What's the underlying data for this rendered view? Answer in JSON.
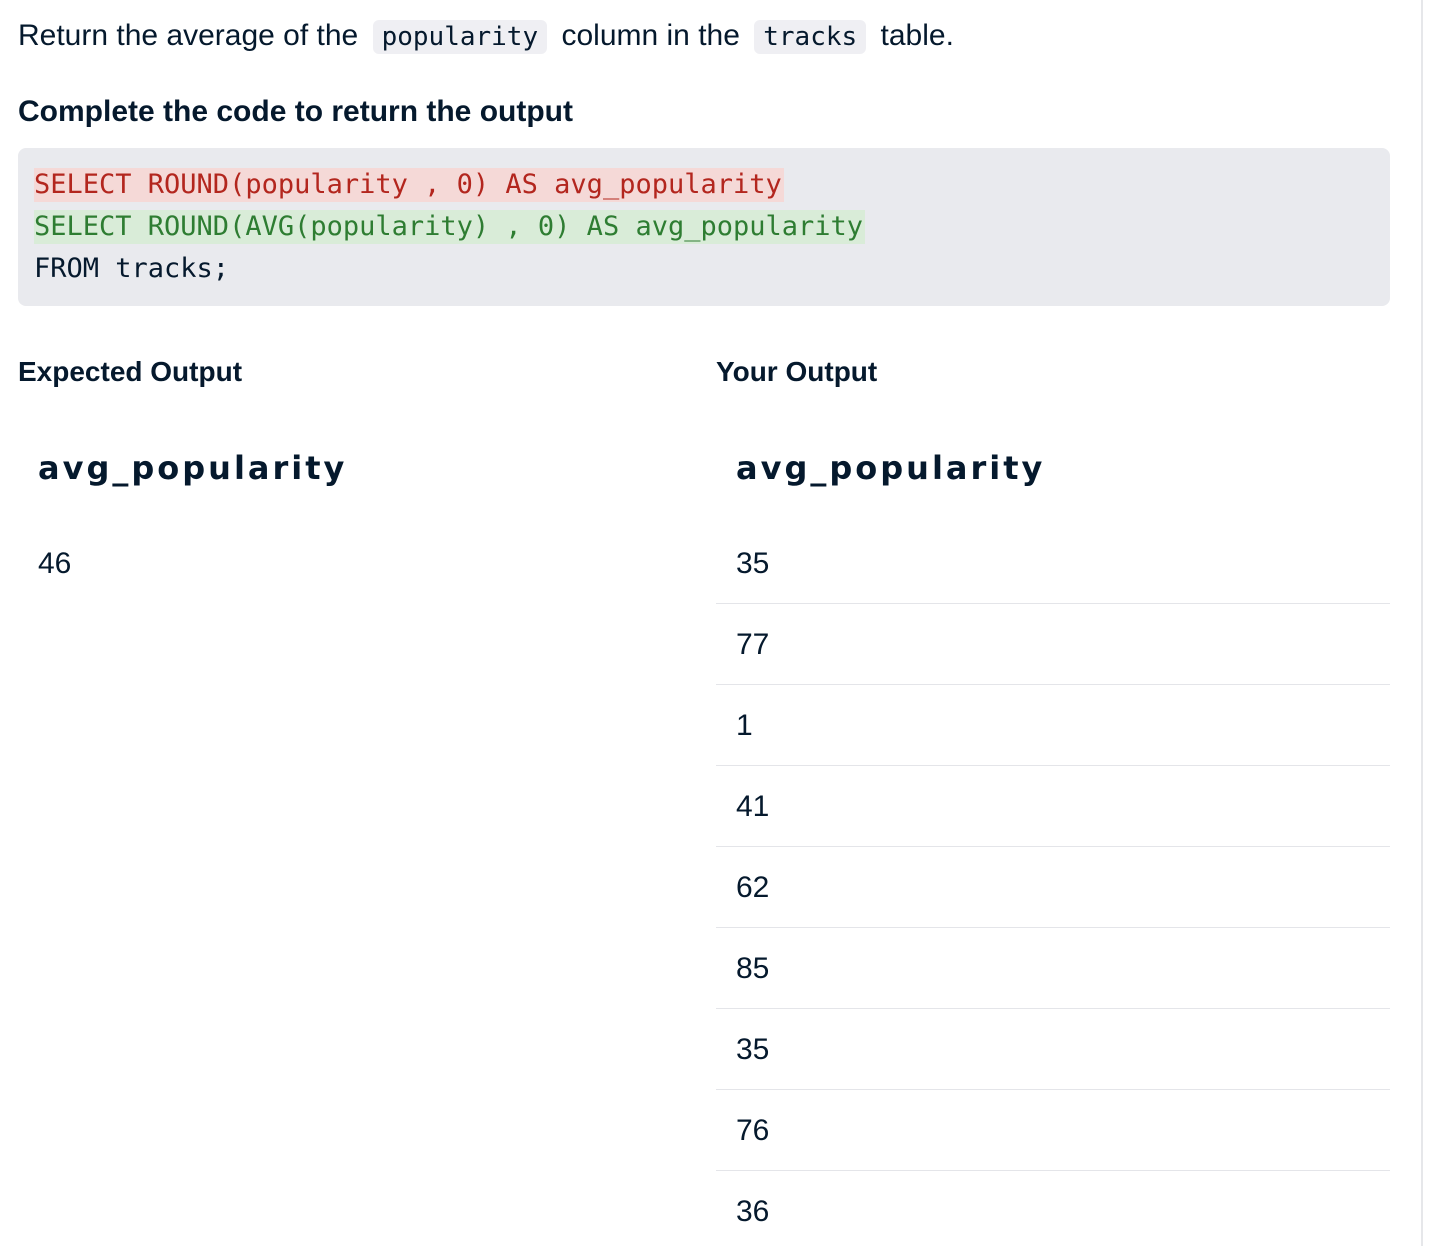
{
  "instruction": {
    "before": "Return the average of the",
    "code1": "popularity",
    "middle": "column in the",
    "code2": "tracks",
    "after": "table."
  },
  "subheading": "Complete the code to return the output",
  "code": {
    "removed_line": "SELECT ROUND(popularity , 0) AS avg_popularity",
    "added_line": "SELECT ROUND(AVG(popularity) , 0) AS avg_popularity",
    "plain_line": "FROM tracks;"
  },
  "expected_output": {
    "title": "Expected Output",
    "column": "avg_popularity",
    "rows": [
      "46"
    ]
  },
  "your_output": {
    "title": "Your Output",
    "column": "avg_popularity",
    "rows": [
      "35",
      "77",
      "1",
      "41",
      "62",
      "85",
      "35",
      "76",
      "36"
    ]
  },
  "colors": {
    "removed_text": "#b3261e",
    "removed_bg": "#f5d9d7",
    "added_text": "#2e7d32",
    "added_bg": "#d9ecd8",
    "code_bg": "#e9eaee"
  }
}
